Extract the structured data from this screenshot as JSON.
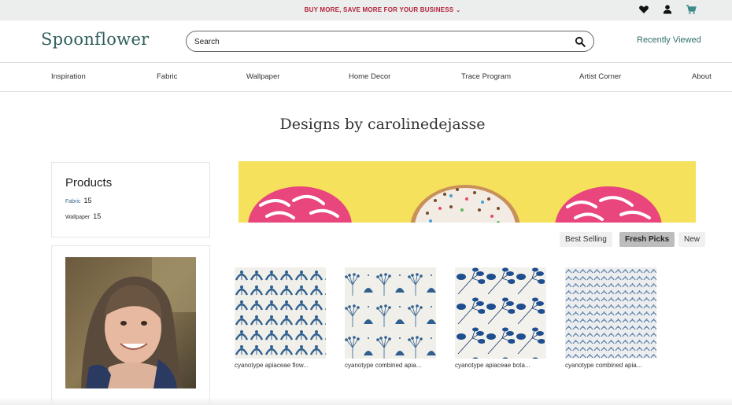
{
  "promo": {
    "text": "BUY MORE, SAVE MORE FOR YOUR BUSINESS",
    "chevron": "⌄"
  },
  "header": {
    "logo": "Spoonflower",
    "search_placeholder": "Search",
    "recently_viewed": "Recently Viewed"
  },
  "icons": [
    "heart-icon",
    "user-icon",
    "cart-icon",
    "search-icon",
    "chevron-down-icon"
  ],
  "colors": {
    "brand": "#2f5f5d",
    "promo_text": "#b3223a",
    "link": "#2f6f6a",
    "banner_bg": "#f5e15c"
  },
  "nav": {
    "items": [
      {
        "label": "Inspiration"
      },
      {
        "label": "Fabric"
      },
      {
        "label": "Wallpaper"
      },
      {
        "label": "Home Decor"
      },
      {
        "label": "Trace Program"
      },
      {
        "label": "Artist Corner"
      },
      {
        "label": "About"
      }
    ]
  },
  "page": {
    "title": "Designs by carolinedejasse"
  },
  "products": {
    "title": "Products",
    "items": [
      {
        "label": "Fabric",
        "count": "15"
      },
      {
        "label": "Wallpaper",
        "count": "15"
      }
    ]
  },
  "sort": {
    "options": [
      {
        "label": "Best Selling"
      },
      {
        "label": "Fresh Picks"
      },
      {
        "label": "New"
      }
    ],
    "selected": "Fresh Picks"
  },
  "designs": [
    {
      "title": "cyanotype apiaceae flow..."
    },
    {
      "title": "cyanotype combined apia..."
    },
    {
      "title": "cyanotype apiaceae bota..."
    },
    {
      "title": "cyanotype combined apia..."
    }
  ]
}
